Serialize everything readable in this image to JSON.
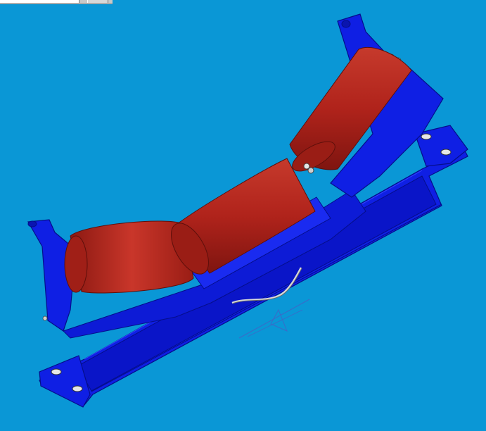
{
  "viewport": {
    "background": "#0a97d6",
    "model": {
      "frame_color": "#0f1fe4",
      "frame_shadow": "#0a15b0",
      "frame_highlight": "#2a3cff",
      "roller_color": "#b0231b",
      "roller_highlight": "#c9362a",
      "roller_shadow": "#7f1510"
    }
  }
}
